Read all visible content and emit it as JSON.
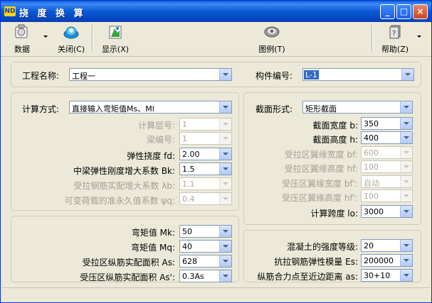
{
  "window": {
    "title": "挠 度 换 算",
    "icon_text": "ND",
    "minimize": "_",
    "maximize": "□",
    "close": "×"
  },
  "toolbar": {
    "data_label": "数据",
    "close_label": "关闭(C)",
    "display_label": "显示(X)",
    "legend_label": "图例(T)",
    "help_label": "帮助(Z)"
  },
  "project": {
    "name_label": "工程名称:",
    "name_value": "工程一",
    "member_label": "构件编号:",
    "member_value": "L-1"
  },
  "calc": {
    "method_label": "计算方式:",
    "method_value": "直接输入弯矩值Ms、Ml",
    "floor_label": "计算层号:",
    "floor_value": "1",
    "beam_label": "梁编号:",
    "beam_value": "1",
    "deflection_label": "弹性挠度 fd:",
    "deflection_value": "2.00",
    "stiffness_label": "中梁弹性刚度增大系数 Bk:",
    "stiffness_value": "1.5",
    "rebar_label": "受拉钢筋实配增大系数 λb:",
    "rebar_value": "1.1",
    "quasi_label": "可变荷载的准永久值系数 ψq:",
    "quasi_value": "0.4"
  },
  "section": {
    "shape_label": "截面形式:",
    "shape_value": "矩形截面",
    "width_label": "截面宽度 b:",
    "width_value": "350",
    "height_label": "截面高度 h:",
    "height_value": "400",
    "tflange_w_label": "受拉区翼缘宽度 bf:",
    "tflange_w_value": "600",
    "tflange_h_label": "受拉区翼缘高度 hf:",
    "tflange_h_value": "100",
    "cflange_w_label": "受压区翼缘宽度 bf':",
    "cflange_w_value": "自动",
    "cflange_h_label": "受压区翼缘高度 hf':",
    "cflange_h_value": "100",
    "span_label": "计算跨度 lo:",
    "span_value": "3000"
  },
  "moments": {
    "mk_label": "弯矩值 Mk:",
    "mk_value": "50",
    "mq_label": "弯矩值 Mq:",
    "mq_value": "40",
    "as_label": "受拉区纵筋实配面积 As:",
    "as_value": "628",
    "as2_label": "受压区纵筋实配面积 As':",
    "as2_value": "0.3As"
  },
  "material": {
    "concrete_label": "混凝土的强度等级:",
    "concrete_value": "20",
    "es_label": "抗拉钢筋弹性模量 Es:",
    "es_value": "200000",
    "as_dist_label": "纵筋合力点至近边距离 as:",
    "as_dist_value": "30+10"
  },
  "colors": {
    "title_bar": "#0a59d4",
    "selection": "#316ac5",
    "window_bg": "#ece9d8"
  }
}
